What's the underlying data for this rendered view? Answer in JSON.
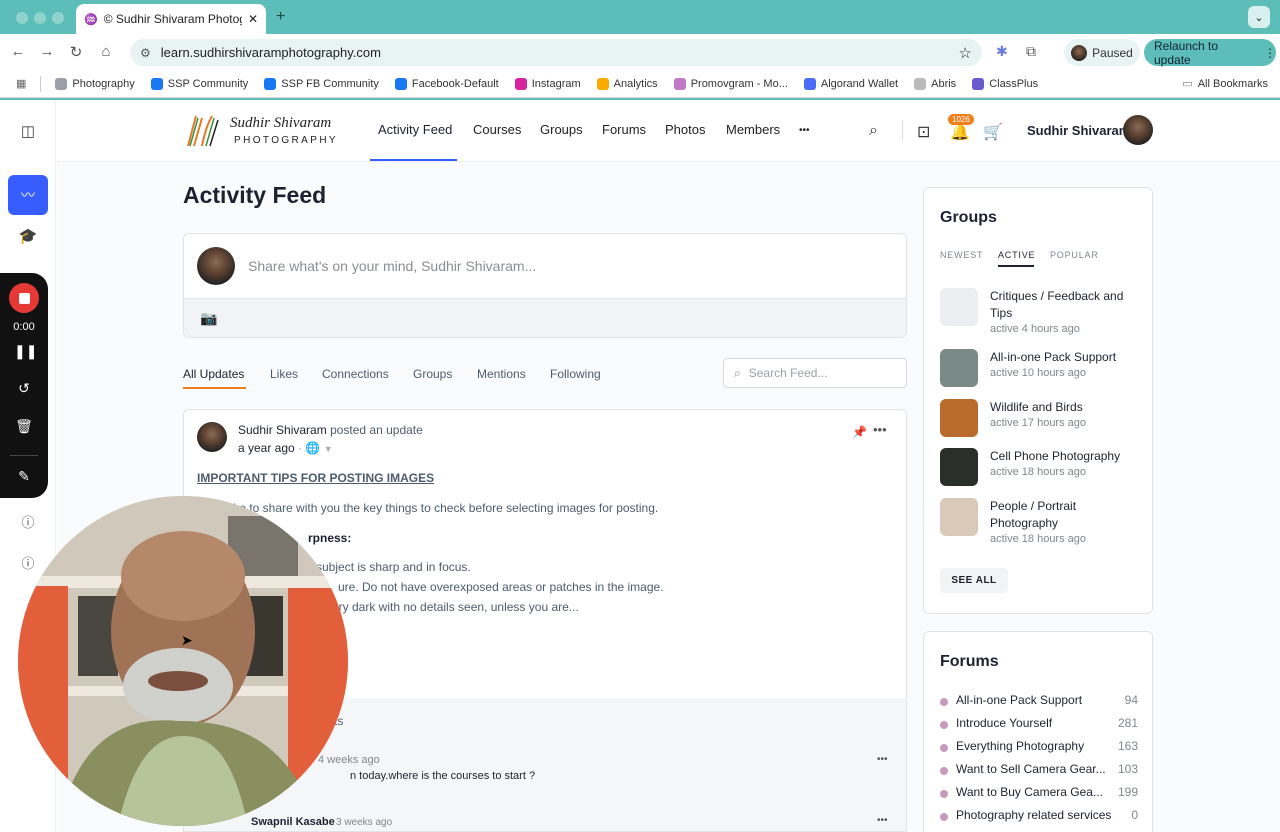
{
  "browser": {
    "tab_title": "© Sudhir Shivaram Photograp",
    "url": "learn.sudhirshivaramphotography.com",
    "paused_label": "Paused",
    "relaunch_label": "Relaunch to update",
    "bookmarks": [
      {
        "label": "Photography",
        "color": "#9aa0a6"
      },
      {
        "label": "SSP Community",
        "color": "#1877f2"
      },
      {
        "label": "SSP FB Community",
        "color": "#1877f2"
      },
      {
        "label": "Facebook-Default",
        "color": "#1877f2"
      },
      {
        "label": "Instagram",
        "color": "#d6249f"
      },
      {
        "label": "Analytics",
        "color": "#f9ab00"
      },
      {
        "label": "Promovgram - Mo...",
        "color": "#c17ac7"
      },
      {
        "label": "Algorand Wallet",
        "color": "#4a6cf7"
      },
      {
        "label": "Abris",
        "color": "#bbbbbb"
      },
      {
        "label": "ClassPlus",
        "color": "#6a5acd"
      }
    ],
    "all_bookmarks_label": "All Bookmarks"
  },
  "recorder": {
    "time": "0:00"
  },
  "header": {
    "logo_script": "Sudhir Shivaram",
    "logo_sub": "PHOTOGRAPHY",
    "nav": [
      "Activity Feed",
      "Courses",
      "Groups",
      "Forums",
      "Photos",
      "Members"
    ],
    "more": "•••",
    "notification_count": "1026",
    "user_name": "Sudhir Shivaram"
  },
  "page": {
    "title": "Activity Feed",
    "composer_placeholder": "Share what's on your mind, Sudhir Shivaram...",
    "feed_tabs": [
      "All Updates",
      "Likes",
      "Connections",
      "Groups",
      "Mentions",
      "Following"
    ],
    "search_placeholder": "Search Feed..."
  },
  "post": {
    "author": "Sudhir Shivaram",
    "action": "posted an update",
    "time": "a year ago",
    "title": "IMPORTANT TIPS FOR POSTING IMAGES",
    "lines": [
      "like to share with you the key things to check before selecting images for posting.",
      "rpness:",
      "subject is sharp and in focus.",
      "ure. Do not have overexposed areas or patches in the image.",
      "very dark with no details seen, unless you are..."
    ],
    "comments_label": "ts",
    "comment1_time": "4 weeks ago",
    "comment1_text": "n today.where is the courses to start ?",
    "comment2_author": "Swapnil Kasabe",
    "comment2_time": "3 weeks ago"
  },
  "groups": {
    "title": "Groups",
    "tabs": [
      "NEWEST",
      "ACTIVE",
      "POPULAR"
    ],
    "items": [
      {
        "name": "Critiques / Feedback and Tips",
        "activity": "active 4 hours ago",
        "color": "#eceef1"
      },
      {
        "name": "All-in-one Pack Support",
        "activity": "active 10 hours ago",
        "color": "#7a8a86"
      },
      {
        "name": "Wildlife and Birds",
        "activity": "active 17 hours ago",
        "color": "#b86b2a"
      },
      {
        "name": "Cell Phone Photography",
        "activity": "active 18 hours ago",
        "color": "#2b2f2a"
      },
      {
        "name": "People / Portrait Photography",
        "activity": "active 18 hours ago",
        "color": "#d9c9b9"
      }
    ],
    "see_all": "SEE ALL"
  },
  "forums": {
    "title": "Forums",
    "items": [
      {
        "name": "All-in-one Pack Support",
        "count": "94"
      },
      {
        "name": "Introduce Yourself",
        "count": "281"
      },
      {
        "name": "Everything Photography",
        "count": "163"
      },
      {
        "name": "Want to Sell Camera Gear...",
        "count": "103"
      },
      {
        "name": "Want to Buy Camera Gea...",
        "count": "199"
      },
      {
        "name": "Photography related services",
        "count": "0"
      }
    ]
  }
}
